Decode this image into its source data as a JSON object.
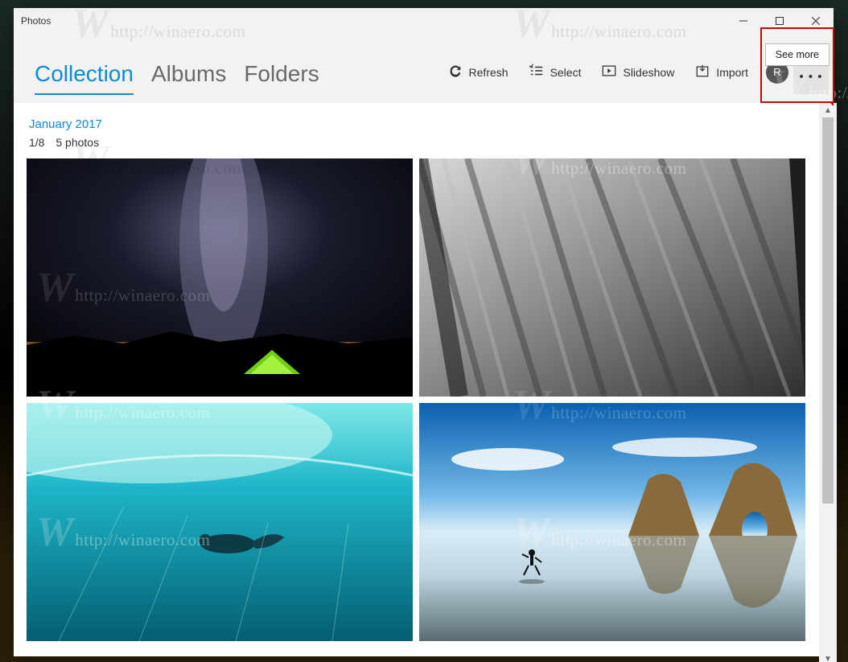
{
  "window": {
    "title": "Photos"
  },
  "tabs": [
    {
      "label": "Collection",
      "active": true
    },
    {
      "label": "Albums",
      "active": false
    },
    {
      "label": "Folders",
      "active": false
    }
  ],
  "commands": {
    "refresh": "Refresh",
    "select": "Select",
    "slideshow": "Slideshow",
    "import": "Import"
  },
  "avatar_initial": "R",
  "tooltip": "See more",
  "section": {
    "date": "January 2017",
    "counter": "1/8",
    "count_label": "5 photos"
  },
  "photos": [
    {
      "name": "milky-way-tent"
    },
    {
      "name": "cliff-face"
    },
    {
      "name": "underwater-swimmer"
    },
    {
      "name": "beach-rocks-runner"
    }
  ],
  "watermark": {
    "text": "http://winaero.com"
  }
}
